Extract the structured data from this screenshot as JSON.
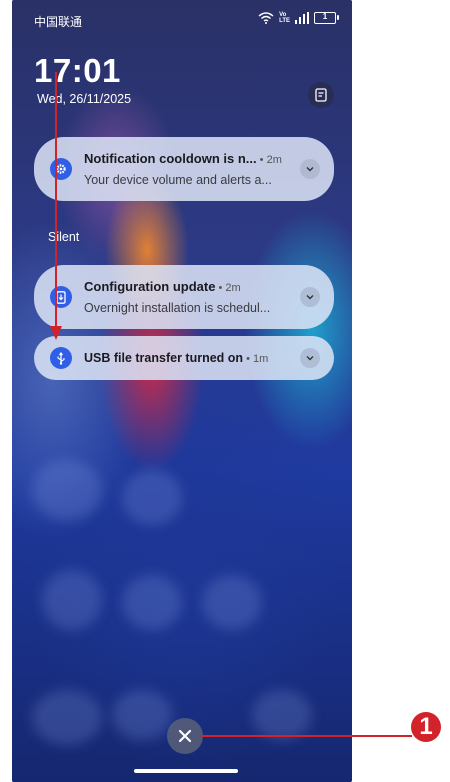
{
  "status_bar": {
    "carrier": "中国联通",
    "icons": [
      "wifi-icon",
      "volte-icon",
      "signal-icon",
      "battery-icon"
    ],
    "volte_top": "Vo",
    "volte_bottom": "LTE",
    "battery_level": "1"
  },
  "lockscreen": {
    "time": "17:01",
    "date": "Wed, 26/11/2025"
  },
  "notifications": [
    {
      "icon": "gear-icon",
      "title": "Notification cooldown is n...",
      "meta": " • 2m",
      "body": "Your device volume and alerts a..."
    }
  ],
  "silent_section": {
    "label": "Silent",
    "items": [
      {
        "icon": "system-update-icon",
        "title": "Configuration update",
        "meta": " • 2m",
        "body": "Overnight installation is schedul..."
      },
      {
        "icon": "usb-icon",
        "title": "USB file transfer turned on",
        "meta": " • 1m"
      }
    ]
  },
  "annotation": {
    "callout_number": "1",
    "color": "#d2232a"
  },
  "colors": {
    "icon_blue": "#2f5fe6",
    "card_bg": "#dce4f6"
  }
}
